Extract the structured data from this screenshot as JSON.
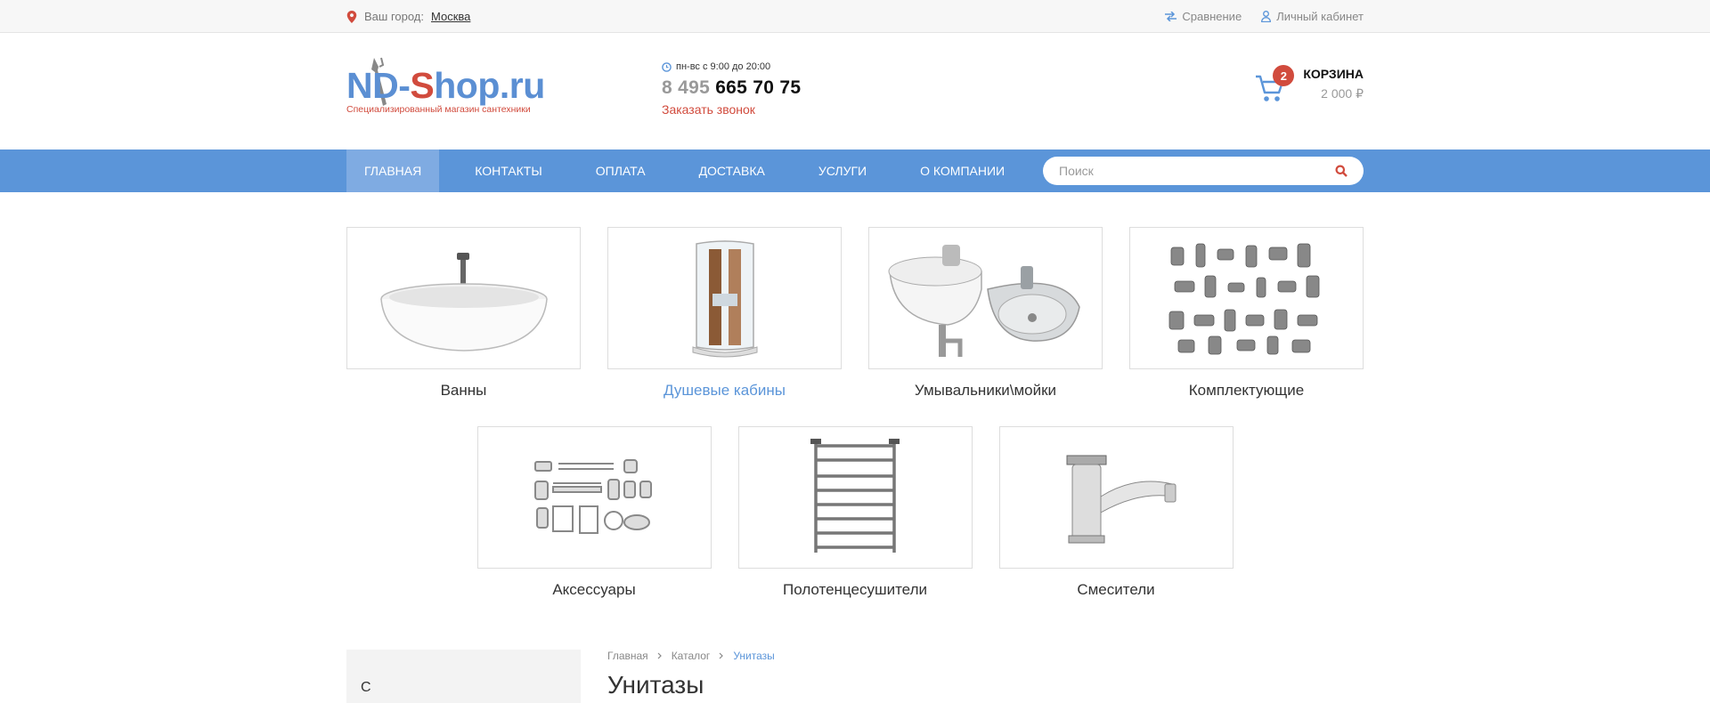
{
  "topbar": {
    "city_label": "Ваш город:",
    "city": "Москва",
    "compare": "Сравнение",
    "account": "Личный кабинет"
  },
  "header": {
    "logo_part1": "N",
    "logo_part2": "D-",
    "logo_part3": "S",
    "logo_part4": "hop.ru",
    "logo_subtitle": "Специализированный магазин сантехники",
    "hours": "пн-вс с 9:00 до 20:00",
    "phone_code": "8 495",
    "phone_number": "665 70 75",
    "callback": "Заказать звонок",
    "cart_count": "2",
    "cart_title": "КОРЗИНА",
    "cart_sum": "2 000 ₽"
  },
  "nav": {
    "items": [
      {
        "label": "ГЛАВНАЯ"
      },
      {
        "label": "КОНТАКТЫ"
      },
      {
        "label": "ОПЛАТА"
      },
      {
        "label": "ДОСТАВКА"
      },
      {
        "label": "УСЛУГИ"
      },
      {
        "label": "О КОМПАНИИ"
      }
    ],
    "search_placeholder": "Поиск"
  },
  "categories": [
    {
      "label": "Ванны"
    },
    {
      "label": "Душевые кабины"
    },
    {
      "label": "Умывальники\\мойки"
    },
    {
      "label": "Комплектующие"
    },
    {
      "label": "Аксессуары"
    },
    {
      "label": "Полотенцесушители"
    },
    {
      "label": "Смесители"
    }
  ],
  "breadcrumb": [
    "Главная",
    "Каталог",
    "Унитазы"
  ],
  "page_title": "Унитазы",
  "sidebar_title": "С",
  "colors": {
    "accent": "#5b95d9",
    "brand_red": "#d14b3d"
  }
}
